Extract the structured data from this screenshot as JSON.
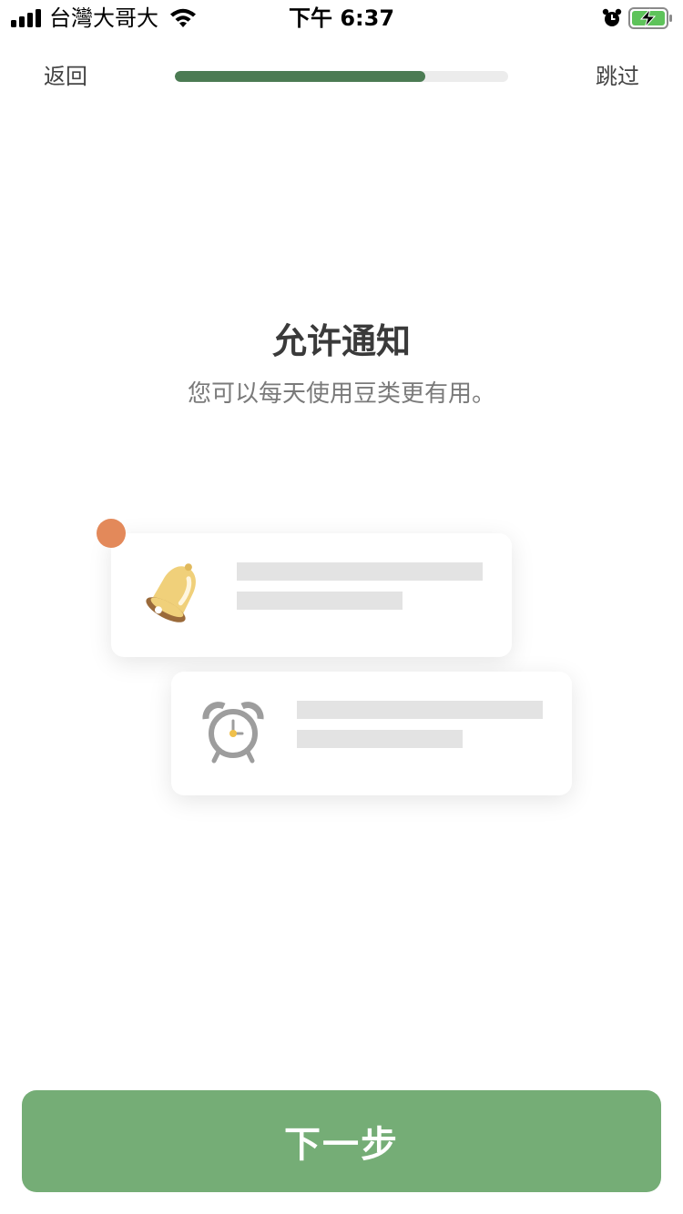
{
  "status_bar": {
    "carrier": "台灣大哥大",
    "time": "下午 6:37",
    "icons": [
      "signal-icon",
      "wifi-icon",
      "alarm-icon",
      "battery-charging-icon"
    ]
  },
  "nav": {
    "back_label": "返回",
    "skip_label": "跳过",
    "progress": 0.75
  },
  "content": {
    "title": "允许通知",
    "subtitle": "您可以每天使用豆类更有用。"
  },
  "illustration": {
    "cards": [
      {
        "icon": "bell-icon"
      },
      {
        "icon": "alarm-clock-icon"
      }
    ]
  },
  "footer": {
    "next_label": "下一步"
  },
  "colors": {
    "accent": "#75ad76",
    "progress": "#4b7b53",
    "dot": "#e3895a"
  }
}
